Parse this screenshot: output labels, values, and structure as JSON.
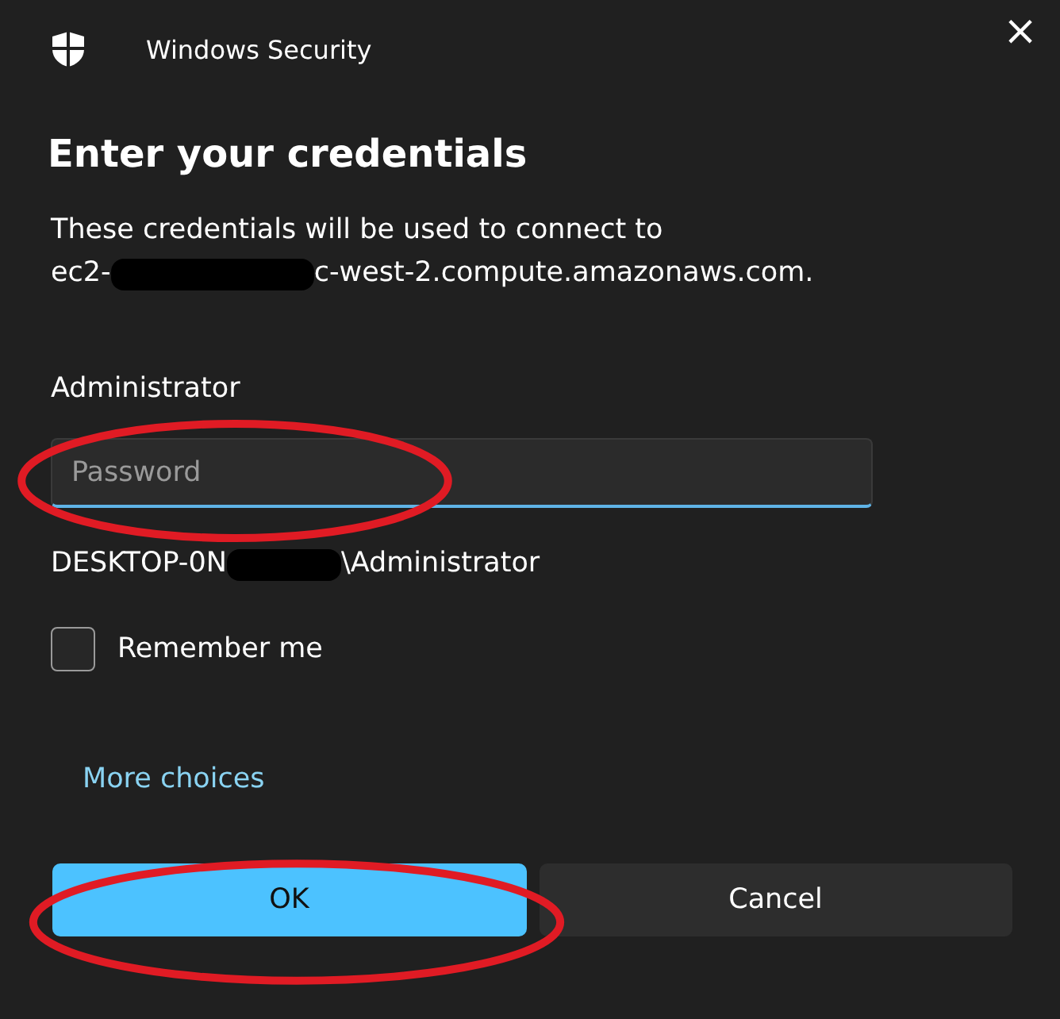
{
  "window": {
    "title": "Windows Security",
    "close": "×"
  },
  "heading": "Enter your credentials",
  "description": "These credentials will be used to connect to",
  "host": {
    "before": "ec2-",
    "after": "c-west-2.compute.amazonaws.com."
  },
  "username": "Administrator",
  "password": {
    "placeholder": "Password",
    "focused": true
  },
  "account": {
    "before": "DESKTOP-0N",
    "after": "\\Administrator"
  },
  "remember": {
    "label": "Remember me",
    "checked": false
  },
  "more_choices": "More choices",
  "buttons": [
    {
      "label": "OK",
      "kind": "primary"
    },
    {
      "label": "Cancel",
      "kind": "secondary"
    }
  ]
}
